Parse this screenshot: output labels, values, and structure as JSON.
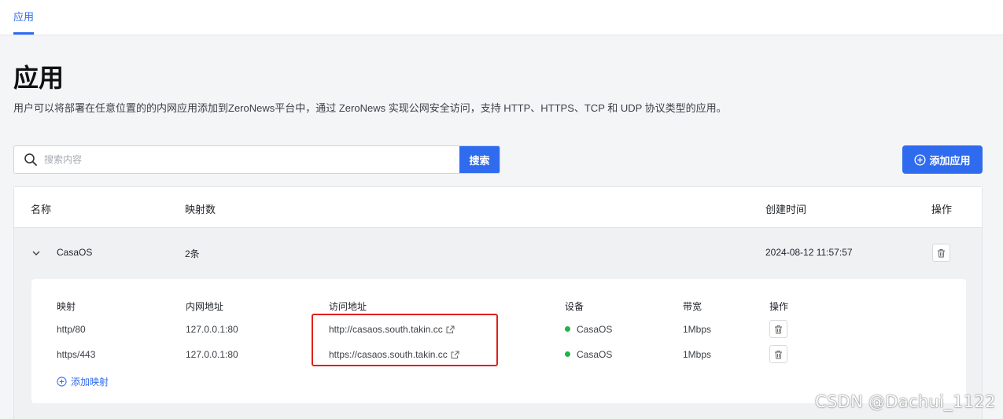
{
  "nav": {
    "tab_label": "应用"
  },
  "page": {
    "title": "应用",
    "description": "用户可以将部署在任意位置的的内网应用添加到ZeroNews平台中，通过 ZeroNews 实现公网安全访问，支持 HTTP、HTTPS、TCP 和 UDP 协议类型的应用。"
  },
  "search": {
    "placeholder": "搜索内容",
    "button_label": "搜索",
    "icon": "search-icon"
  },
  "add_app_button": {
    "label": "添加应用",
    "icon": "plus-circle-icon"
  },
  "table": {
    "headers": {
      "name": "名称",
      "mappings": "映射数",
      "created": "创建时间",
      "actions": "操作"
    },
    "rows": [
      {
        "name": "CasaOS",
        "mapping_count": "2条",
        "created_at": "2024-08-12 11:57:57",
        "expanded": true
      }
    ]
  },
  "detail": {
    "headers": {
      "mapping": "映射",
      "internal": "内网地址",
      "access": "访问地址",
      "device": "设备",
      "bandwidth": "带宽",
      "actions": "操作"
    },
    "rows": [
      {
        "mapping": "http/80",
        "internal": "127.0.0.1:80",
        "access": "http://casaos.south.takin.cc",
        "device": "CasaOS",
        "device_status_color": "#22b14c",
        "bandwidth": "1Mbps"
      },
      {
        "mapping": "https/443",
        "internal": "127.0.0.1:80",
        "access": "https://casaos.south.takin.cc",
        "device": "CasaOS",
        "device_status_color": "#22b14c",
        "bandwidth": "1Mbps"
      }
    ],
    "add_mapping_label": "添加映射"
  },
  "watermark": "CSDN @Dachui_1122",
  "colors": {
    "accent": "#2f6bef",
    "highlight": "#e0201a",
    "online": "#22b14c"
  }
}
